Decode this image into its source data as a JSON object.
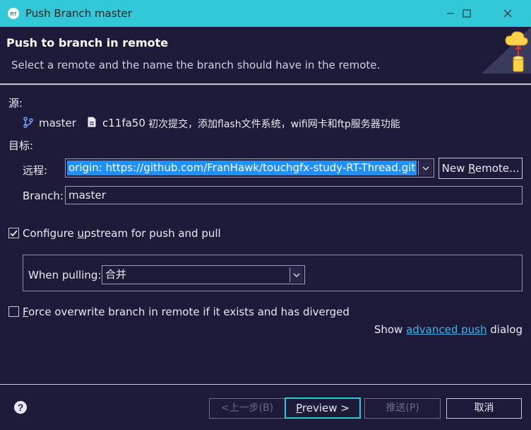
{
  "window": {
    "title": "Push Branch master"
  },
  "header": {
    "title": "Push to branch in remote",
    "description": "Select a remote and the name the branch should have in the remote."
  },
  "source": {
    "label": "源:",
    "branch": "master",
    "commit_id": "c11fa50",
    "commit_message": "初次提交，添加flash文件系统，wifi网卡和ftp服务器功能"
  },
  "target": {
    "label": "目标:",
    "remote_label": "远程:",
    "remote_value": "origin: https://github.com/FranHawk/touchgfx-study-RT-Thread.git",
    "new_remote_button": {
      "pre": "New ",
      "mnemonic": "R",
      "post": "emote..."
    },
    "branch_label": "Branch:",
    "branch_value": "master"
  },
  "upstream": {
    "checkbox_pre": "Configure ",
    "checkbox_mnemonic": "u",
    "checkbox_post": "pstream for push and pull",
    "checked": true,
    "when_pulling_label": "When pulling:",
    "when_pulling_value": "合并"
  },
  "force": {
    "checkbox_mnemonic": "F",
    "checkbox_post": "orce overwrite branch in remote if it exists and has diverged",
    "checked": false
  },
  "advanced": {
    "pre": "Show ",
    "link": "advanced push",
    "post": " dialog"
  },
  "footer": {
    "back_button": "<上一步(B)",
    "preview_button": {
      "mnemonic": "P",
      "post": "review >"
    },
    "push_button": "推送(P)",
    "cancel_button": "取消"
  },
  "colors": {
    "titlebar": "#33c8d8",
    "background": "#1e1a3a",
    "selection": "#1e90ff",
    "link": "#3fb5f0"
  }
}
